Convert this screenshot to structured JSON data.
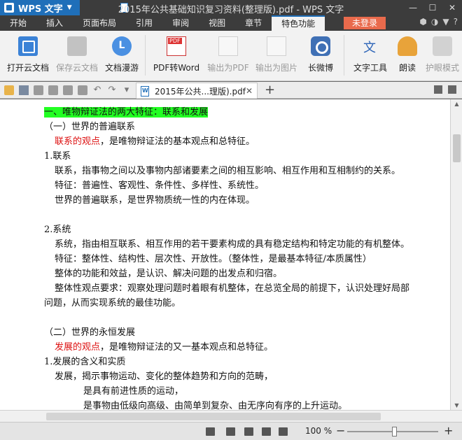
{
  "titlebar": {
    "app_name": "WPS 文字",
    "title": "2015年公共基础知识复习资料(整理版).pdf - WPS 文字"
  },
  "menu": {
    "items": [
      "开始",
      "插入",
      "页面布局",
      "引用",
      "审阅",
      "视图",
      "章节",
      "特色功能"
    ],
    "active": "特色功能",
    "login": "未登录"
  },
  "ribbon": {
    "buttons": [
      {
        "label": "打开云文档",
        "icon": "cloud-open-icon"
      },
      {
        "label": "保存云文档",
        "icon": "cloud-save-icon"
      },
      {
        "label": "文档漫游",
        "icon": "roam-icon"
      },
      {
        "label": "PDF转Word",
        "icon": "pdf-icon"
      },
      {
        "label": "输出为PDF",
        "icon": "export-pdf-icon"
      },
      {
        "label": "输出为图片",
        "icon": "export-image-icon"
      },
      {
        "label": "长微博",
        "icon": "weibo-icon"
      },
      {
        "label": "文字工具",
        "icon": "text-tools-icon"
      },
      {
        "label": "朗读",
        "icon": "read-aloud-icon"
      },
      {
        "label": "护眼模式",
        "icon": "eye-care-icon"
      }
    ]
  },
  "tabs": {
    "doc_tab": "2015年公共...理版).pdf"
  },
  "doc": {
    "heading": "一、唯物辩证法的两大特征：联系和发展",
    "sub1": "（一）世界的普遍联系",
    "l_view1_red": "联系的观点",
    "l_view1_rest": "，是唯物辩证法的基本观点和总特征。",
    "h_1": "1.联系",
    "p1": "联系，指事物之间以及事物内部诸要素之间的相互影响、相互作用和互相制约的关系。",
    "p2": "特征：普遍性、客观性、条件性、多样性、系统性。",
    "p3": "世界的普遍联系，是世界物质统一性的内在体现。",
    "h_2": "2.系统",
    "p4": "系统，指由相互联系、相互作用的若干要素构成的具有稳定结构和特定功能的有机整体。",
    "p5": "特征：整体性、结构性、层次性、开放性。（整体性，是最基本特征/本质属性）",
    "p6": "整体的功能和效益，是认识、解决问题的出发点和归宿。",
    "p7a": "整体性观点要求：观察处理问题时着眼有机整体，在总览全局的前提下，认识处理好局部",
    "p7b": "问题，从而实现系统的最佳功能。",
    "sub2": "（二）世界的永恒发展",
    "l_view2_red": "发展的观点",
    "l_view2_rest": "，是唯物辩证法的又一基本观点和总特征。",
    "h_3": "1.发展的含义和实质",
    "p8": "发展，揭示事物运动、变化的整体趋势和方向的范畴，",
    "p9": "是具有前进性质的运动，",
    "p10": "是事物由低级向高级、由简单到复杂、由无序向有序的上升运动。"
  },
  "status": {
    "zoom": "100 %"
  }
}
